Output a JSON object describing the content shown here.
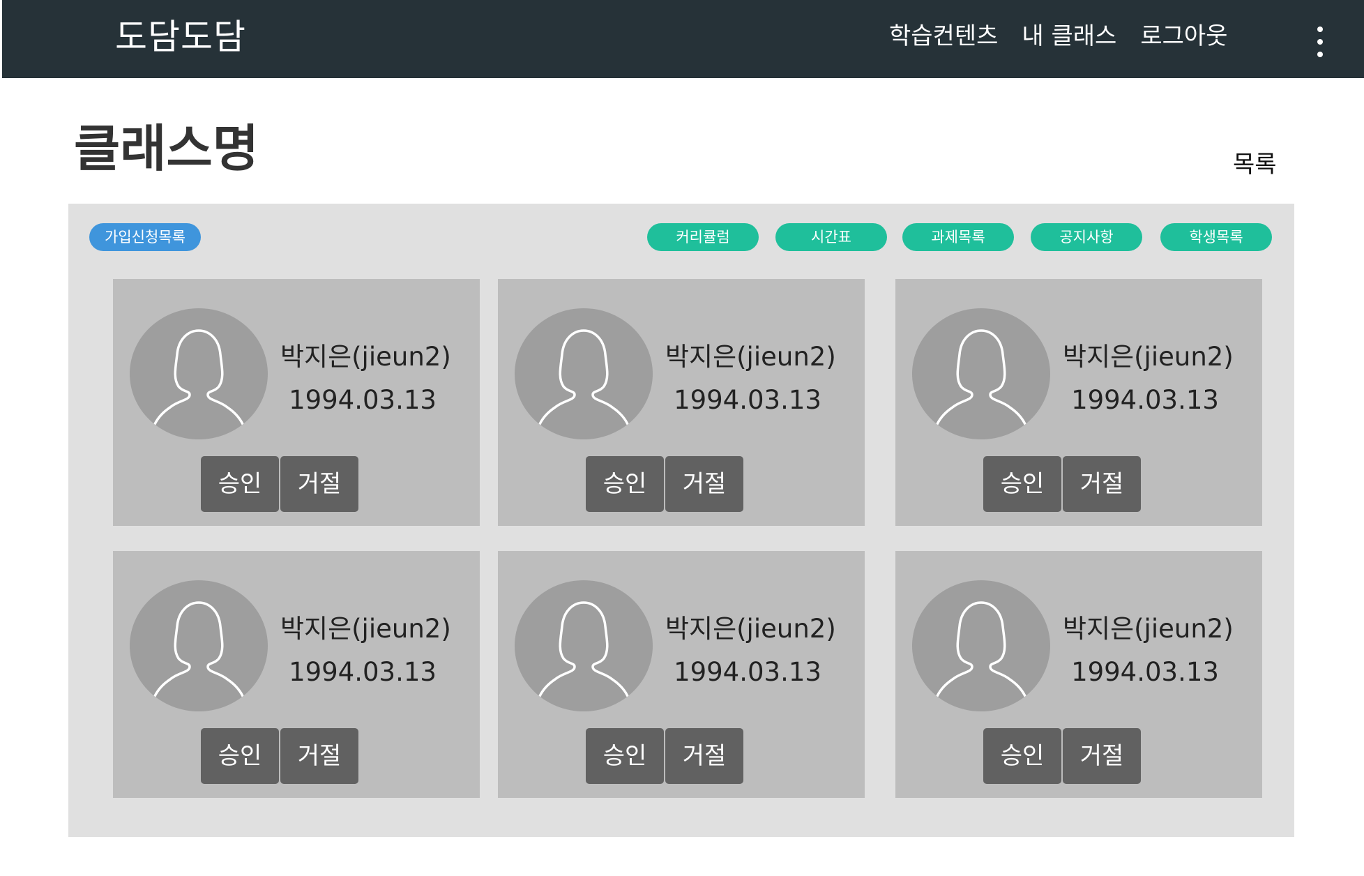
{
  "app": {
    "brand": "도담도담"
  },
  "nav": {
    "items": [
      "학습컨텐츠",
      "내 클래스",
      "로그아웃"
    ]
  },
  "page": {
    "title": "클래스명",
    "list_link": "목록"
  },
  "tabs": {
    "join_requests": "가입신청목록",
    "items": [
      "커리큘럼",
      "시간표",
      "과제목록",
      "공지사항",
      "학생목록"
    ]
  },
  "requests": [
    {
      "name": "박지은(jieun2)",
      "birthdate": "1994.03.13",
      "approve": "승인",
      "reject": "거절"
    },
    {
      "name": "박지은(jieun2)",
      "birthdate": "1994.03.13",
      "approve": "승인",
      "reject": "거절"
    },
    {
      "name": "박지은(jieun2)",
      "birthdate": "1994.03.13",
      "approve": "승인",
      "reject": "거절"
    },
    {
      "name": "박지은(jieun2)",
      "birthdate": "1994.03.13",
      "approve": "승인",
      "reject": "거절"
    },
    {
      "name": "박지은(jieun2)",
      "birthdate": "1994.03.13",
      "approve": "승인",
      "reject": "거절"
    },
    {
      "name": "박지은(jieun2)",
      "birthdate": "1994.03.13",
      "approve": "승인",
      "reject": "거절"
    }
  ],
  "colors": {
    "topbar": "#263238",
    "panel": "#e0e0e0",
    "card": "#bdbdbd",
    "button": "#616161",
    "pill_blue": "#3f95dc",
    "pill_green": "#1fbf9b"
  },
  "icons": {
    "avatar": "person-silhouette-icon",
    "menu": "more-vertical-icon"
  }
}
